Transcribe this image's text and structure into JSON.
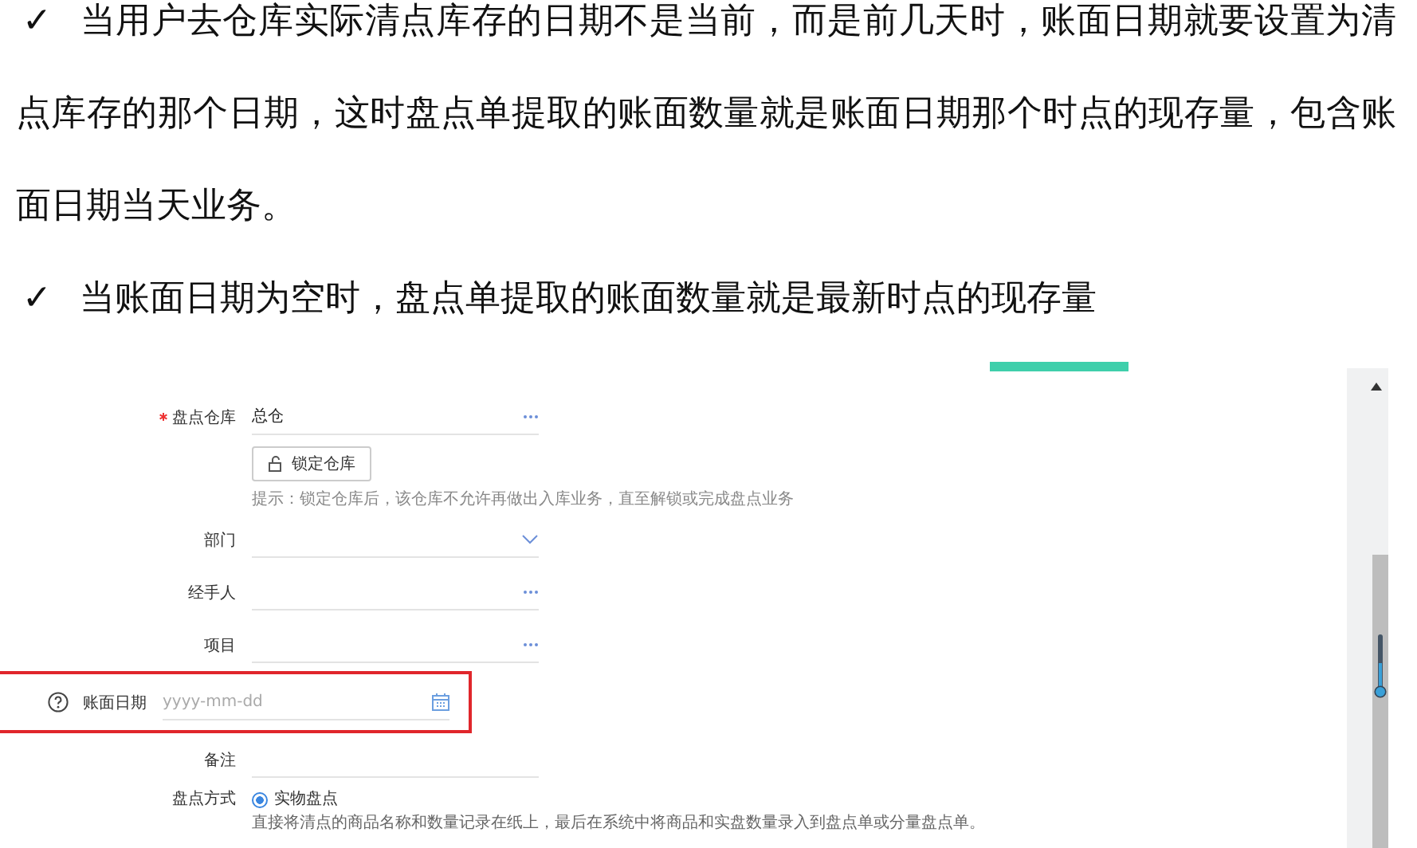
{
  "notes": [
    {
      "mark": "✓",
      "text": "当用户去仓库实际清点库存的日期不是当前，而是前几天时，账面日期就要设置为清点库存的那个日期，这时盘点单提取的账面数量就是账面日期那个时点的现存量，包含账面日期当天业务。"
    },
    {
      "mark": "✓",
      "text": "当账面日期为空时，盘点单提取的账面数量就是最新时点的现存量"
    }
  ],
  "form": {
    "fields": [
      {
        "kind": "picker",
        "label": "盘点仓库",
        "required": true,
        "help": false,
        "highlighted": false,
        "value": "总仓"
      },
      {
        "kind": "lock",
        "button": "锁定仓库",
        "hint": "提示：锁定仓库后，该仓库不允许再做出入库业务，直至解锁或完成盘点业务"
      },
      {
        "kind": "dropdown",
        "label": "部门",
        "required": false,
        "help": false,
        "highlighted": false
      },
      {
        "kind": "picker",
        "label": "经手人",
        "required": false,
        "help": false,
        "highlighted": false
      },
      {
        "kind": "picker",
        "label": "项目",
        "required": false,
        "help": false,
        "highlighted": false
      },
      {
        "kind": "date",
        "label": "账面日期",
        "required": false,
        "help": true,
        "highlighted": true,
        "placeholder": "yyyy-mm-dd"
      },
      {
        "kind": "text",
        "label": "备注",
        "required": false,
        "help": false,
        "highlighted": false
      },
      {
        "kind": "radio",
        "label": "盘点方式",
        "options": [
          {
            "label": "实物盘点",
            "selected": true
          }
        ],
        "description": "直接将清点的商品名称和数量记录在纸上，最后在系统中将商品和实盘数量录入到盘点单或分量盘点单。"
      }
    ]
  }
}
